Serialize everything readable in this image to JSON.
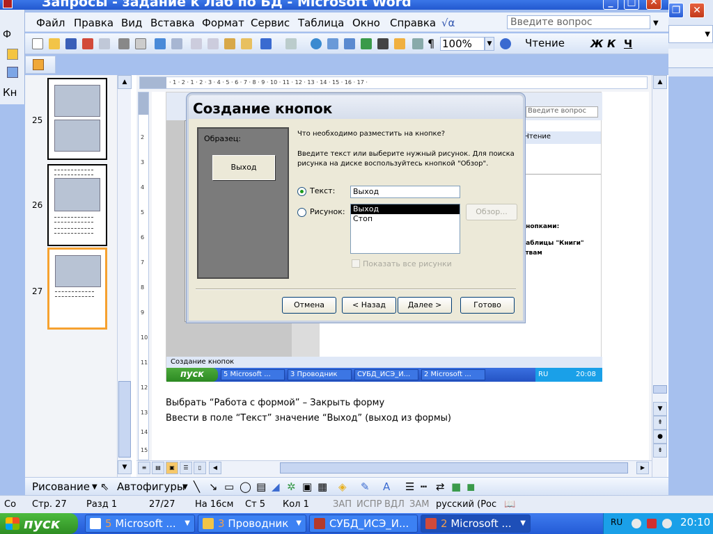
{
  "window": {
    "title": "Запросы - задание к Лаб по БД - Microsoft Word",
    "min": "_",
    "max": "□",
    "close": "✕"
  },
  "menu": {
    "items": [
      "Файл",
      "Правка",
      "Вид",
      "Вставка",
      "Формат",
      "Сервис",
      "Таблица",
      "Окно",
      "Справка"
    ],
    "ask_placeholder": "Введите вопрос"
  },
  "toolbar": {
    "zoom": "100%",
    "reading": "Чтение",
    "bold": "Ж",
    "italic": "К",
    "underline": "Ч"
  },
  "outer_left": {
    "menu_glyph": "Ф",
    "label": "Кн"
  },
  "thumbnails": [
    {
      "num": "25"
    },
    {
      "num": "26"
    },
    {
      "num": "27"
    }
  ],
  "ruler": {
    "marks": "· 1 · 2 · 1 · 2 · 3 · 4 · 5 · 6 · 7 · 8 · 9 · 10 · 11 · 12 · 13 · 14 · 15 · 16 · 17 ·",
    "vmarks": [
      "2",
      "3",
      "4",
      "5",
      "6",
      "7",
      "8",
      "9",
      "10",
      "11",
      "12",
      "13",
      "14",
      "15"
    ]
  },
  "embedded": {
    "ask": "Введите вопрос",
    "reading": "Чтение",
    "status": "Создание кнопок",
    "start": "пуск",
    "tasks": [
      "5 Microsoft ...",
      "3 Проводник",
      "СУБД_ИСЭ_И...",
      "2 Microsoft ..."
    ],
    "lang": "RU",
    "clock": "20:08",
    "side_texts": [
      "кнопками:",
      "Таблицы \"Книги\"",
      "ствам"
    ]
  },
  "dialog": {
    "title": "Создание кнопок",
    "preview_label": "Образец:",
    "preview_button": "Выход",
    "question": "Что необходимо разместить на кнопке?",
    "hint": "Введите текст или выберите нужный рисунок.  Для поиска рисунка на диске воспользуйтесь кнопкой \"Обзор\".",
    "text_label": "Текст:",
    "text_value": "Выход",
    "picture_label": "Рисунок:",
    "pictures": [
      "Выход",
      "Стоп"
    ],
    "browse": "Обзор...",
    "show_all": "Показать все рисунки",
    "cancel": "Отмена",
    "back": "< Назад",
    "next": "Далее >",
    "finish": "Готово"
  },
  "document": {
    "line1": "Выбрать “Работа с формой” – Закрыть форму",
    "line2": "Ввести в поле “Текст” значение “Выход” (выход из формы)"
  },
  "drawing": {
    "draw": "Рисование",
    "autoshapes": "Автофигуры"
  },
  "status": {
    "prefix": "Co",
    "page": "Стр. 27",
    "section": "Разд 1",
    "pages": "27/27",
    "at": "На 16см",
    "line": "Ст 5",
    "col": "Кол 1",
    "rec": "ЗАП",
    "trk": "ИСПР",
    "ext": "ВДЛ",
    "ovr": "ЗАМ",
    "lang": "русский (Рос"
  },
  "taskbar": {
    "start": "пуск",
    "tasks": [
      {
        "num": "5",
        "label": "Microsoft ..."
      },
      {
        "num": "3",
        "label": "Проводник"
      },
      {
        "num": "",
        "label": "СУБД_ИСЭ_И..."
      },
      {
        "num": "2",
        "label": "Microsoft ..."
      }
    ],
    "lang": "RU",
    "clock": "20:10"
  }
}
